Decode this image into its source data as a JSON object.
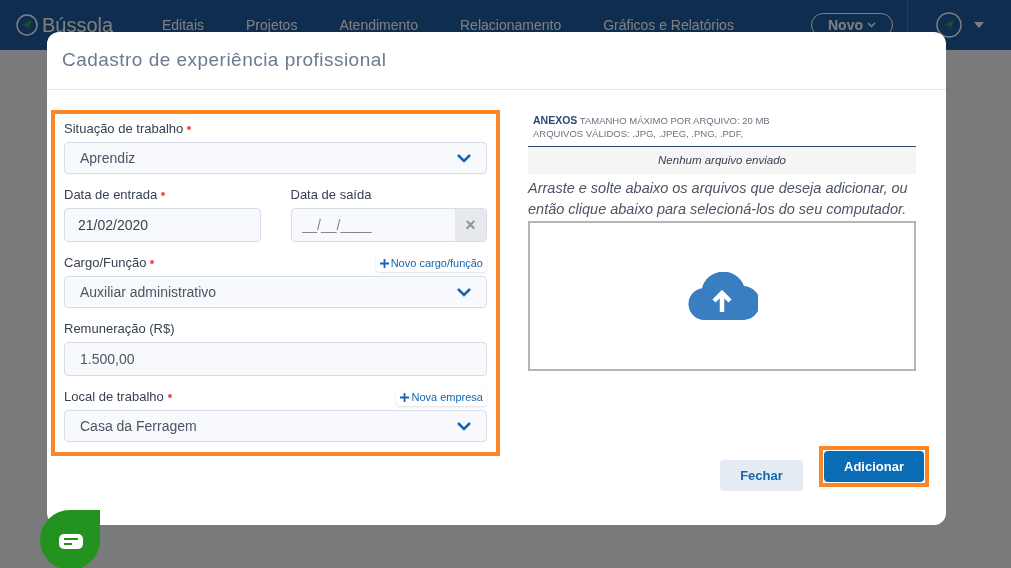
{
  "navbar": {
    "logo": "Bússola",
    "items": [
      {
        "label": "Editais"
      },
      {
        "label": "Projetos"
      },
      {
        "label": "Atendimento"
      },
      {
        "label": "Relacionamento"
      },
      {
        "label": "Gráficos e Relatórios"
      }
    ],
    "new_button": "Novo"
  },
  "modal": {
    "title": "Cadastro de experiência profissional",
    "fields": [
      {
        "kind": "select",
        "label": "Situação de trabalho",
        "required": true,
        "value": "Aprendiz"
      },
      {
        "kind": "dates",
        "items": [
          {
            "label": "Data de entrada",
            "required": true,
            "value": "21/02/2020"
          },
          {
            "label": "Data de saída",
            "required": false,
            "placeholder": "__/__/____",
            "clear": "×"
          }
        ]
      },
      {
        "kind": "select",
        "label": "Cargo/Função",
        "required": true,
        "value": "Auxiliar administrativo",
        "add_button": "Novo cargo/função"
      },
      {
        "kind": "text",
        "label": "Remuneração (R$)",
        "required": false,
        "value": "1.500,00"
      },
      {
        "kind": "select",
        "label": "Local de trabalho",
        "required": true,
        "value": "Casa da Ferragem",
        "add_button": "Nova empresa"
      }
    ],
    "attachments": {
      "title": "ANEXOS",
      "max_size": "TAMANHO MÁXIMO POR ARQUIVO: 20 MB",
      "valid": "ARQUIVOS VÁLIDOS: .JPG, .JPEG, .PNG, .PDF,",
      "empty": "Nenhum arquivo enviado",
      "instructions": "Arraste e solte abaixo os arquivos que deseja adicionar, ou então clique abaixo para selecioná-los do seu computador."
    },
    "buttons": [
      {
        "label": "Fechar",
        "kind": "secondary"
      },
      {
        "label": "Adicionar",
        "kind": "primary"
      }
    ]
  }
}
